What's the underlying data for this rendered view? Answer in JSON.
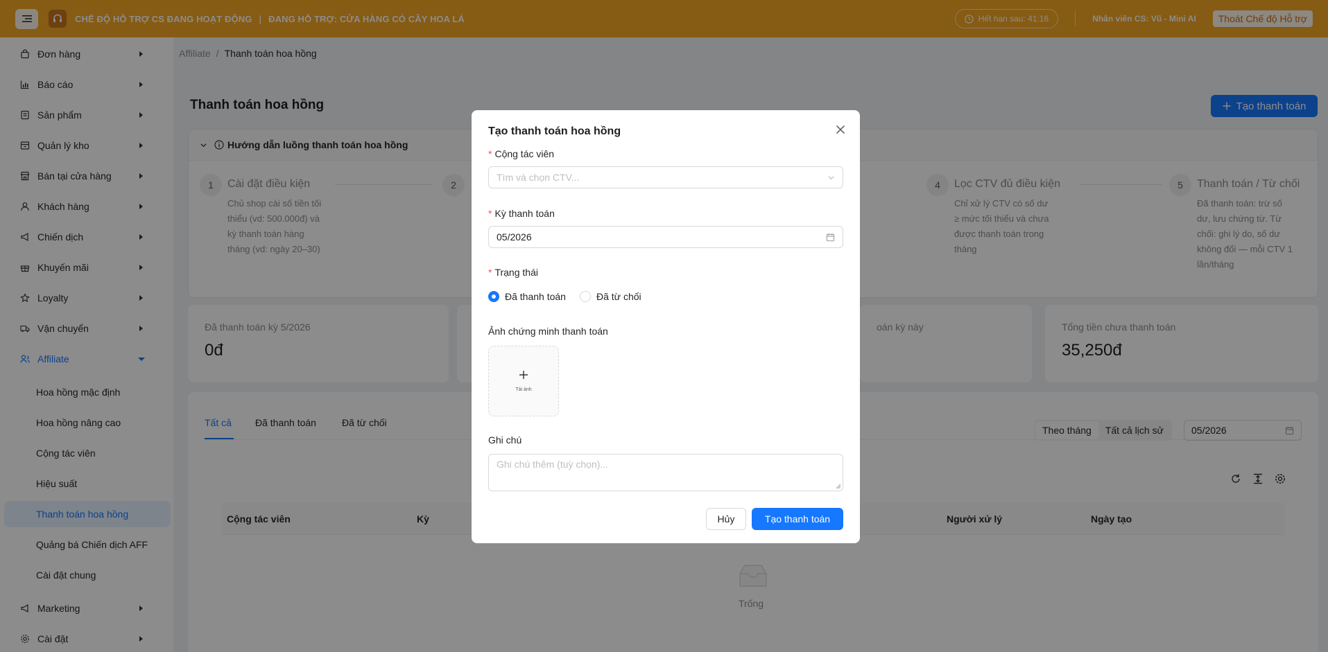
{
  "banner": {
    "mode_text": "CHẾ ĐỘ HỖ TRỢ CS ĐANG HOẠT ĐỘNG",
    "separator": "|",
    "store_text": "ĐANG HỖ TRỢ: CỬA HÀNG CÓ CÂY HOA LÁ",
    "timer": "Hết hạn sau: 41:16",
    "staff": "Nhân viên CS: Vũ - Mini AI",
    "exit_label": "Thoát Chế độ Hỗ trợ"
  },
  "sidebar": {
    "items": [
      {
        "label": "Đơn hàng",
        "icon": "bag-icon"
      },
      {
        "label": "Báo cáo",
        "icon": "chart-icon"
      },
      {
        "label": "Sản phẩm",
        "icon": "product-icon"
      },
      {
        "label": "Quản lý kho",
        "icon": "warehouse-icon"
      },
      {
        "label": "Bán tại cửa hàng",
        "icon": "store-icon"
      },
      {
        "label": "Khách hàng",
        "icon": "user-icon"
      },
      {
        "label": "Chiến dịch",
        "icon": "megaphone-icon"
      },
      {
        "label": "Khuyến mãi",
        "icon": "gift-icon"
      },
      {
        "label": "Loyalty",
        "icon": "star-icon"
      },
      {
        "label": "Vận chuyển",
        "icon": "truck-icon"
      },
      {
        "label": "Affiliate",
        "icon": "affiliate-icon"
      }
    ],
    "affiliate_sub": [
      "Hoa hồng mặc định",
      "Hoa hồng nâng cao",
      "Cộng tác viên",
      "Hiệu suất",
      "Thanh toán hoa hồng",
      "Quảng bá Chiến dịch AFF",
      "Cài đặt chung"
    ],
    "bottom_items": [
      {
        "label": "Marketing",
        "icon": "megaphone-icon"
      },
      {
        "label": "Cài đặt",
        "icon": "gear-icon"
      }
    ]
  },
  "breadcrumb": {
    "parent": "Affiliate",
    "sep": "/",
    "current": "Thanh toán hoa hồng"
  },
  "page": {
    "title": "Thanh toán hoa hồng",
    "create_label": "Tạo thanh toán"
  },
  "guide": {
    "title": "Hướng dẫn luồng thanh toán hoa hồng",
    "steps": [
      {
        "num": "1",
        "title": "Cài đặt điều kiện",
        "desc": "Chủ shop cài số tiền tối thiểu (vd: 500.000đ) và kỳ thanh toán hàng tháng (vd: ngày 20–30)"
      },
      {
        "num": "2",
        "title": "",
        "desc": ""
      },
      {
        "num": "4",
        "title": "Lọc CTV đủ điều kiện",
        "desc": "Chỉ xử lý CTV có số dư ≥ mức tối thiểu và chưa được thanh toán trong tháng"
      },
      {
        "num": "5",
        "title": "Thanh toán / Từ chối",
        "desc": "Đã thanh toán: trừ số dư, lưu chứng từ. Từ chối: ghi lý do, số dư không đổi — mỗi CTV 1 lần/tháng"
      }
    ]
  },
  "stats": {
    "paid_label": "Đã thanh toán kỳ 5/2026",
    "paid_value": "0đ",
    "mid_label_partial": "oán kỳ này",
    "unpaid_label": "Tổng tiền chưa thanh toán",
    "unpaid_value": "35,250đ"
  },
  "table": {
    "tabs": [
      "Tất cả",
      "Đã thanh toán",
      "Đã từ chối"
    ],
    "seg": [
      "Theo tháng",
      "Tất cả lịch sử"
    ],
    "month": "05/2026",
    "columns": [
      "Cộng tác viên",
      "Kỳ",
      "Người xử lý",
      "Ngày tạo"
    ],
    "empty": "Trống"
  },
  "modal": {
    "title": "Tạo thanh toán hoa hồng",
    "ctv_label": "Cộng tác viên",
    "ctv_placeholder": "Tìm và chọn CTV...",
    "period_label": "Kỳ thanh toán",
    "period_value": "05/2026",
    "status_label": "Trạng thái",
    "status_paid": "Đã thanh toán",
    "status_rejected": "Đã từ chối",
    "proof_label": "Ảnh chứng minh thanh toán",
    "upload_text": "Tải ảnh",
    "note_label": "Ghi chú",
    "note_placeholder": "Ghi chú thêm (tuỳ chọn)...",
    "cancel_label": "Hủy",
    "submit_label": "Tạo thanh toán",
    "required_mark": "*"
  },
  "colors": {
    "banner": "#f5a623",
    "primary": "#1677ff",
    "required": "#ff4d4f"
  }
}
